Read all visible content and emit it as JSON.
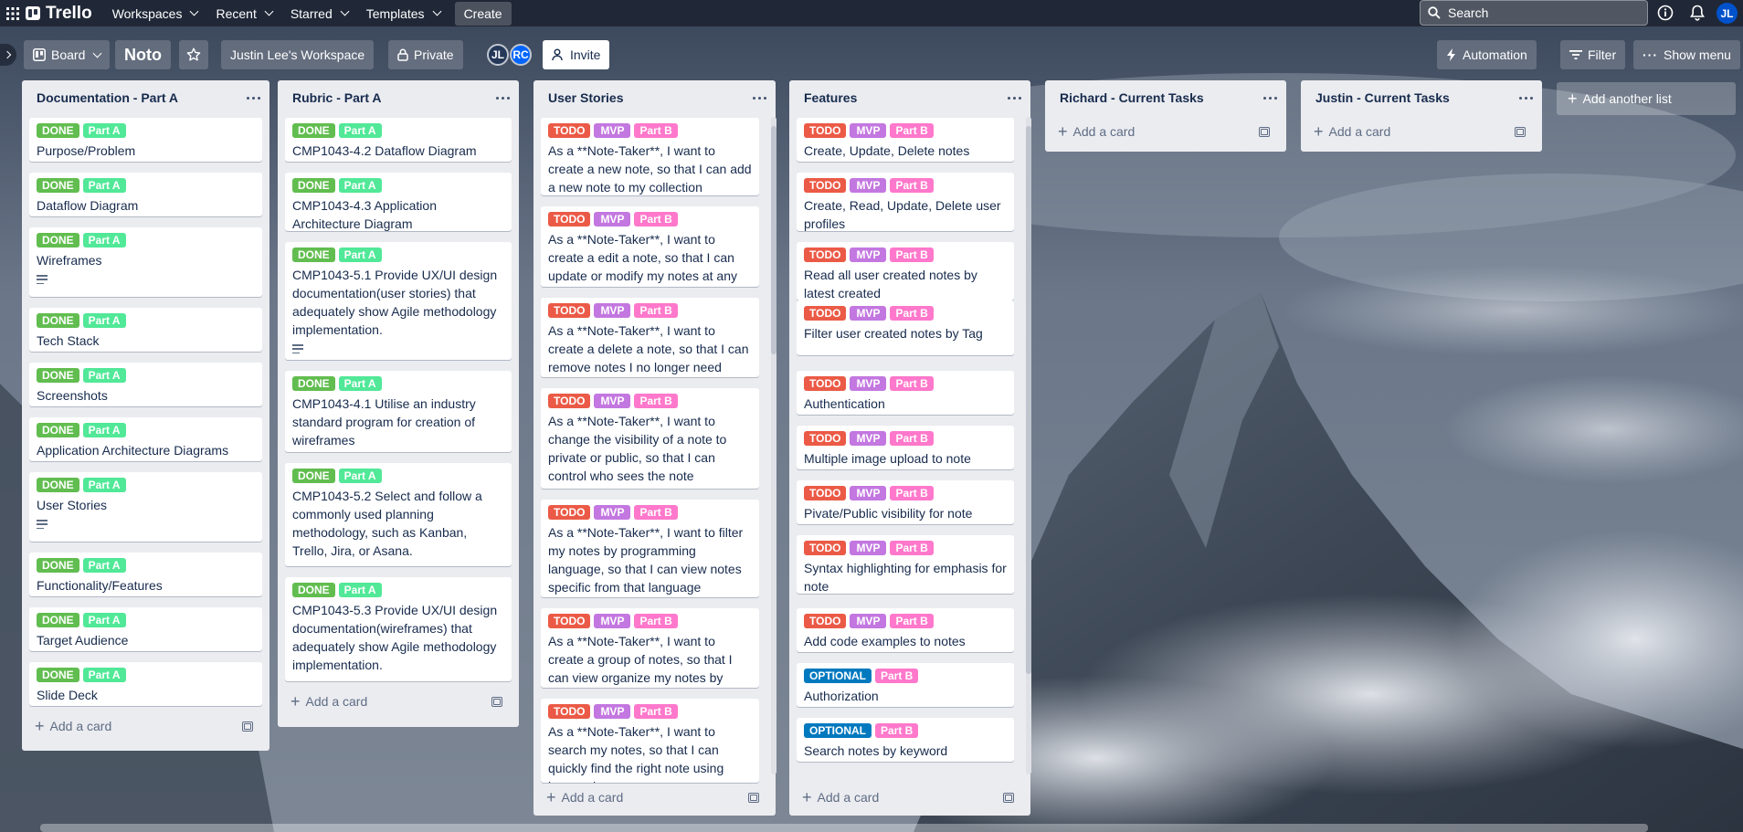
{
  "colors": {
    "done": "#61bd4f",
    "partA": "#51e898",
    "todo": "#eb5a46",
    "mvp": "#c377e0",
    "partB": "#ff78cb",
    "optional": "#0079bf"
  },
  "topbar": {
    "logo": "Trello",
    "nav": [
      "Workspaces",
      "Recent",
      "Starred",
      "Templates"
    ],
    "create": "Create",
    "search_placeholder": "Search",
    "avatar": "JL"
  },
  "boardbar": {
    "view": "Board",
    "title": "Noto",
    "workspace": "Justin Lee's Workspace",
    "visibility": "Private",
    "members": [
      "JL",
      "RC"
    ],
    "invite": "Invite",
    "automation": "Automation",
    "filter": "Filter",
    "show_menu": "Show menu"
  },
  "add_list": "Add another list",
  "add_card": "Add a card",
  "lists": [
    {
      "title": "Documentation - Part A",
      "cards": [
        {
          "labels": [
            [
              "DONE",
              "done"
            ],
            [
              "Part A",
              "partA"
            ]
          ],
          "text": "Purpose/Problem"
        },
        {
          "labels": [
            [
              "DONE",
              "done"
            ],
            [
              "Part A",
              "partA"
            ]
          ],
          "text": "Dataflow Diagram"
        },
        {
          "labels": [
            [
              "DONE",
              "done"
            ],
            [
              "Part A",
              "partA"
            ]
          ],
          "text": "Wireframes",
          "desc": true
        },
        {
          "labels": [
            [
              "DONE",
              "done"
            ],
            [
              "Part A",
              "partA"
            ]
          ],
          "text": "Tech Stack"
        },
        {
          "labels": [
            [
              "DONE",
              "done"
            ],
            [
              "Part A",
              "partA"
            ]
          ],
          "text": "Screenshots"
        },
        {
          "labels": [
            [
              "DONE",
              "done"
            ],
            [
              "Part A",
              "partA"
            ]
          ],
          "text": "Application Architecture Diagrams"
        },
        {
          "labels": [
            [
              "DONE",
              "done"
            ],
            [
              "Part A",
              "partA"
            ]
          ],
          "text": "User Stories",
          "desc": true
        },
        {
          "labels": [
            [
              "DONE",
              "done"
            ],
            [
              "Part A",
              "partA"
            ]
          ],
          "text": "Functionality/Features"
        },
        {
          "labels": [
            [
              "DONE",
              "done"
            ],
            [
              "Part A",
              "partA"
            ]
          ],
          "text": "Target Audience"
        },
        {
          "labels": [
            [
              "DONE",
              "done"
            ],
            [
              "Part A",
              "partA"
            ]
          ],
          "text": "Slide Deck"
        }
      ]
    },
    {
      "title": "Rubric - Part A",
      "cards": [
        {
          "labels": [
            [
              "DONE",
              "done"
            ],
            [
              "Part A",
              "partA"
            ]
          ],
          "text": "CMP1043-4.2 Dataflow Diagram"
        },
        {
          "labels": [
            [
              "DONE",
              "done"
            ],
            [
              "Part A",
              "partA"
            ]
          ],
          "text": "CMP1043-4.3 Application Architecture Diagram"
        },
        {
          "labels": [
            [
              "DONE",
              "done"
            ],
            [
              "Part A",
              "partA"
            ]
          ],
          "text": "CMP1043-5.1 Provide UX/UI design documentation(user stories) that adequately show Agile methodology implementation.",
          "desc": true
        },
        {
          "labels": [
            [
              "DONE",
              "done"
            ],
            [
              "Part A",
              "partA"
            ]
          ],
          "text": "CMP1043-4.1 Utilise an industry standard program for creation of wireframes"
        },
        {
          "labels": [
            [
              "DONE",
              "done"
            ],
            [
              "Part A",
              "partA"
            ]
          ],
          "text": "CMP1043-5.2 Select and follow a commonly used planning methodology, such as Kanban, Trello, Jira, or Asana."
        },
        {
          "labels": [
            [
              "DONE",
              "done"
            ],
            [
              "Part A",
              "partA"
            ]
          ],
          "text": "CMP1043-5.3 Provide UX/UI design documentation(wireframes) that adequately show Agile methodology implementation."
        }
      ]
    },
    {
      "title": "User Stories",
      "cards": [
        {
          "labels": [
            [
              "TODO",
              "todo"
            ],
            [
              "MVP",
              "mvp"
            ],
            [
              "Part B",
              "partB"
            ]
          ],
          "text": "As a **Note-Taker**, I want to create a new note, so that I can add a new note to my collection"
        },
        {
          "labels": [
            [
              "TODO",
              "todo"
            ],
            [
              "MVP",
              "mvp"
            ],
            [
              "Part B",
              "partB"
            ]
          ],
          "text": "As a **Note-Taker**, I want to create a edit a note, so that I can update or modify my notes at any time"
        },
        {
          "labels": [
            [
              "TODO",
              "todo"
            ],
            [
              "MVP",
              "mvp"
            ],
            [
              "Part B",
              "partB"
            ]
          ],
          "text": "As a **Note-Taker**, I want to create a delete a note, so that I can remove notes I no longer need"
        },
        {
          "labels": [
            [
              "TODO",
              "todo"
            ],
            [
              "MVP",
              "mvp"
            ],
            [
              "Part B",
              "partB"
            ]
          ],
          "text": "As a **Note-Taker**, I want to change the visibility of a note to private or public, so that I can control who sees the note"
        },
        {
          "labels": [
            [
              "TODO",
              "todo"
            ],
            [
              "MVP",
              "mvp"
            ],
            [
              "Part B",
              "partB"
            ]
          ],
          "text": "As a **Note-Taker**, I want to filter my notes by programming language, so that I can view notes specific from that language"
        },
        {
          "labels": [
            [
              "TODO",
              "todo"
            ],
            [
              "MVP",
              "mvp"
            ],
            [
              "Part B",
              "partB"
            ]
          ],
          "text": "As a **Note-Taker**, I want to create a group of notes, so that I can view organize my notes by groups"
        },
        {
          "labels": [
            [
              "TODO",
              "todo"
            ],
            [
              "MVP",
              "mvp"
            ],
            [
              "Part B",
              "partB"
            ]
          ],
          "text": "As a **Note-Taker**, I want to search my notes, so that I can quickly find the right note using keywords"
        }
      ]
    },
    {
      "title": "Features",
      "cards": [
        {
          "labels": [
            [
              "TODO",
              "todo"
            ],
            [
              "MVP",
              "mvp"
            ],
            [
              "Part B",
              "partB"
            ]
          ],
          "text": "Create, Update, Delete notes"
        },
        {
          "labels": [
            [
              "TODO",
              "todo"
            ],
            [
              "MVP",
              "mvp"
            ],
            [
              "Part B",
              "partB"
            ]
          ],
          "text": "Create, Read, Update, Delete user profiles"
        },
        {
          "labels": [
            [
              "TODO",
              "todo"
            ],
            [
              "MVP",
              "mvp"
            ],
            [
              "Part B",
              "partB"
            ]
          ],
          "text": "Read all user created notes by latest created"
        },
        {
          "labels": [
            [
              "TODO",
              "todo"
            ],
            [
              "MVP",
              "mvp"
            ],
            [
              "Part B",
              "partB"
            ]
          ],
          "text": "Filter user created notes by Tag"
        },
        {
          "labels": [
            [
              "TODO",
              "todo"
            ],
            [
              "MVP",
              "mvp"
            ],
            [
              "Part B",
              "partB"
            ]
          ],
          "text": "Authentication"
        },
        {
          "labels": [
            [
              "TODO",
              "todo"
            ],
            [
              "MVP",
              "mvp"
            ],
            [
              "Part B",
              "partB"
            ]
          ],
          "text": "Multiple image upload to note"
        },
        {
          "labels": [
            [
              "TODO",
              "todo"
            ],
            [
              "MVP",
              "mvp"
            ],
            [
              "Part B",
              "partB"
            ]
          ],
          "text": "Pivate/Public visibility for note"
        },
        {
          "labels": [
            [
              "TODO",
              "todo"
            ],
            [
              "MVP",
              "mvp"
            ],
            [
              "Part B",
              "partB"
            ]
          ],
          "text": "Syntax highlighting for emphasis for note"
        },
        {
          "labels": [
            [
              "TODO",
              "todo"
            ],
            [
              "MVP",
              "mvp"
            ],
            [
              "Part B",
              "partB"
            ]
          ],
          "text": "Add code examples to notes"
        },
        {
          "labels": [
            [
              "OPTIONAL",
              "optional"
            ],
            [
              "Part B",
              "partB"
            ]
          ],
          "text": "Authorization"
        },
        {
          "labels": [
            [
              "OPTIONAL",
              "optional"
            ],
            [
              "Part B",
              "partB"
            ]
          ],
          "text": "Search notes by keyword"
        }
      ]
    },
    {
      "title": "Richard - Current Tasks",
      "cards": []
    },
    {
      "title": "Justin - Current Tasks",
      "cards": []
    }
  ]
}
